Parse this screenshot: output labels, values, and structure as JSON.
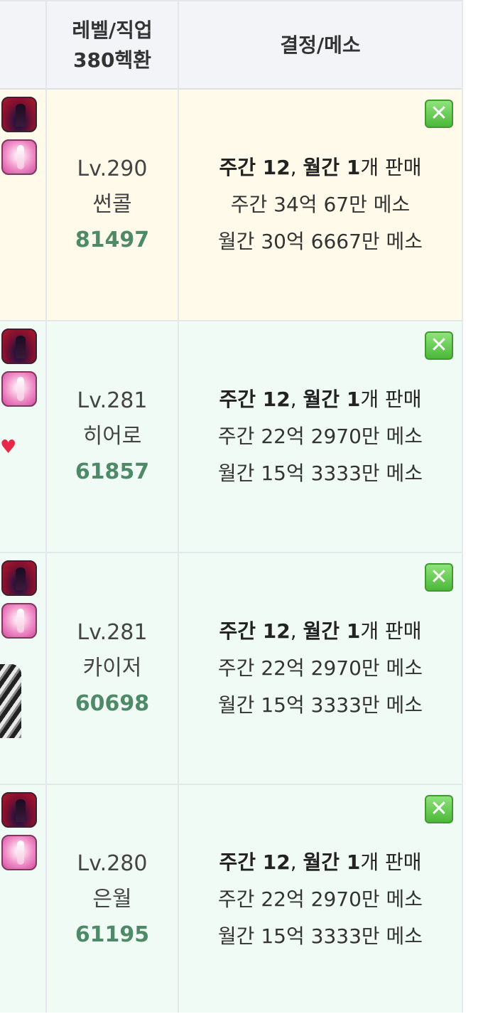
{
  "header": {
    "level_job_line1": "레벨/직업",
    "level_job_line2": "380헥환",
    "crystal_meso": "결정/메소"
  },
  "colors": {
    "yellow_row": "#fffaea",
    "green_row": "#f0fbf5",
    "score": "#4e8a68",
    "close_button": "#4cb83a"
  },
  "rows": [
    {
      "level": "Lv.290",
      "job": "썬콜",
      "score": "81497",
      "sale_prefix": "주간 12",
      "sale_mid": ", ",
      "sale_monthly": "월간 1",
      "sale_suffix": "개 판매",
      "weekly_meso": "주간 34억 67만 메소",
      "monthly_meso": "월간 30억 6667만 메소",
      "icons": [
        "dark-cape-icon",
        "pink-weapon-icon"
      ]
    },
    {
      "level": "Lv.281",
      "job": "히어로",
      "score": "61857",
      "sale_prefix": "주간 12",
      "sale_mid": ", ",
      "sale_monthly": "월간 1",
      "sale_suffix": "개 판매",
      "weekly_meso": "주간 22억 2970만 메소",
      "monthly_meso": "월간 15억 3333만 메소",
      "icons": [
        "dark-cape-icon",
        "pink-weapon-icon",
        "heart-icon"
      ]
    },
    {
      "level": "Lv.281",
      "job": "카이저",
      "score": "60698",
      "sale_prefix": "주간 12",
      "sale_mid": ", ",
      "sale_monthly": "월간 1",
      "sale_suffix": "개 판매",
      "weekly_meso": "주간 22억 2970만 메소",
      "monthly_meso": "월간 15억 3333만 메소",
      "icons": [
        "dark-cape-icon",
        "pink-weapon-icon",
        "striped-item-icon"
      ]
    },
    {
      "level": "Lv.280",
      "job": "은월",
      "score": "61195",
      "sale_prefix": "주간 12",
      "sale_mid": ", ",
      "sale_monthly": "월간 1",
      "sale_suffix": "개 판매",
      "weekly_meso": "주간 22억 2970만 메소",
      "monthly_meso": "월간 15억 3333만 메소",
      "icons": [
        "dark-cape-icon",
        "pink-weapon-icon"
      ]
    }
  ]
}
